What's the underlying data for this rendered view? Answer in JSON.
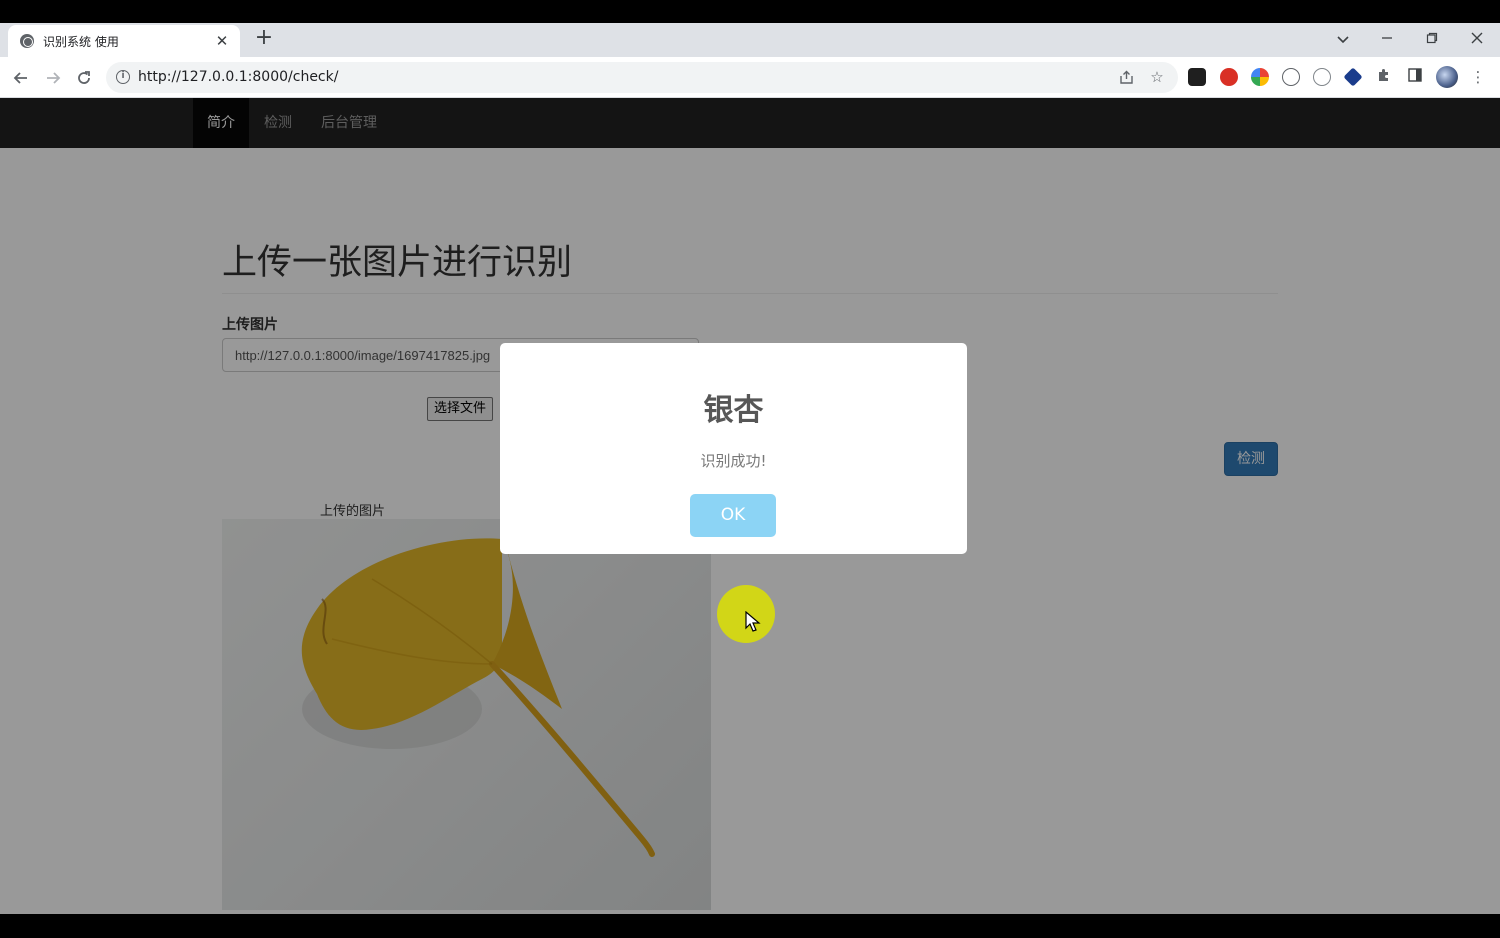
{
  "browser": {
    "tab_title": "识别系统 使用",
    "tab_close": "✕",
    "new_tab": "+",
    "url": "http://127.0.0.1:8000/check/"
  },
  "navbar": {
    "items": [
      {
        "label": "简介",
        "active": true
      },
      {
        "label": "检测",
        "active": false
      },
      {
        "label": "后台管理",
        "active": false
      }
    ]
  },
  "main": {
    "title": "上传一张图片进行识别",
    "upload_label": "上传图片",
    "url_value": "http://127.0.0.1:8000/image/1697417825.jpg",
    "file_button": "选择文件",
    "detect_button": "检测",
    "image_caption": "上传的图片"
  },
  "modal": {
    "title": "银杏",
    "text": "识别成功!",
    "ok_label": "OK"
  },
  "colors": {
    "accent_button": "#337ab7",
    "ok_button": "#8cd4f5",
    "leaf": "#e2b628",
    "cursor_highlight": "#dce100"
  }
}
